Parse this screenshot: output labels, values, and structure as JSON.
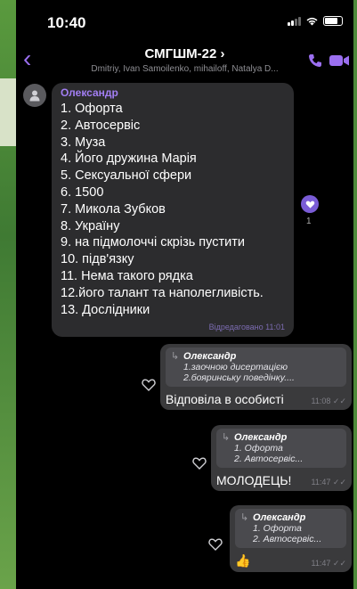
{
  "status_bar": {
    "time": "10:40"
  },
  "header": {
    "back_icon": "chevron-left-icon",
    "title": "СМГШМ-22 ›",
    "members": "Dmitriy, Ivan Samoilenko, mihailoff, Natalya D...",
    "call_icon": "phone-icon",
    "video_icon": "video-camera-icon",
    "accent_color": "#9b6ff0"
  },
  "incoming_message": {
    "sender": "Олександр",
    "lines": [
      "1. Офорта",
      "2. Автосервіс",
      "3.  Муза",
      "4. Його дружина Марія",
      "5. Сексуальної сфери",
      "6. 1500",
      "7. Микола Зубков",
      "8. Україну",
      "9. на підмолоччі скрізь пустити",
      "10. підв'язку",
      "11. Нема такого рядка",
      "12.його талант та наполегливість.",
      "13. Дослідники"
    ],
    "edited_label": "Відредаговано 11:01",
    "reaction_count": "1"
  },
  "outgoing_messages": [
    {
      "quote_name": "Олександр",
      "quote_lines": [
        "1.заочною дисертацією",
        "2.бояринську поведінку...."
      ],
      "text": "Відповіла в особисті",
      "time": "11:08"
    },
    {
      "quote_name": "Олександр",
      "quote_lines": [
        "1. Офорта",
        "2. Автосервіс..."
      ],
      "text": "МОЛОДЕЦЬ!",
      "time": "11:47"
    },
    {
      "quote_name": "Олександр",
      "quote_lines": [
        "1. Офорта",
        "2. Автосервіс..."
      ],
      "text": "👍",
      "time": "11:47"
    }
  ]
}
